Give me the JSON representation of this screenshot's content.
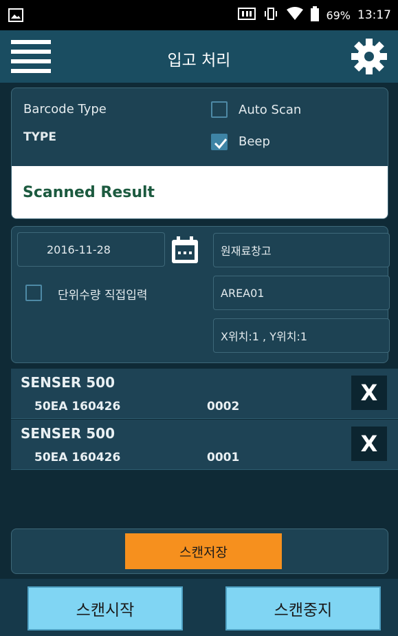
{
  "status_bar": {
    "battery": "69%",
    "time": "13:17"
  },
  "app_bar": {
    "title": "입고 처리",
    "menu_icon": "hamburger-menu-icon",
    "settings_icon": "gear-icon"
  },
  "scan_panel": {
    "barcode_type_label": "Barcode Type",
    "type_value": "TYPE",
    "auto_scan_label": "Auto Scan",
    "auto_scan_checked": false,
    "beep_label": "Beep",
    "beep_checked": true,
    "scanned_result_label": "Scanned Result"
  },
  "location_panel": {
    "date": "2016-11-28",
    "warehouse": "원재료창고",
    "area": "AREA01",
    "position": "X위치:1 , Y위치:1",
    "direct_input_label": "단위수량 직접입력",
    "direct_input_checked": false
  },
  "items": [
    {
      "name": "SENSER 500",
      "info": "50EA  160426",
      "seq": "0002",
      "delete_label": "X"
    },
    {
      "name": "SENSER 500",
      "info": "50EA  160426",
      "seq": "0001",
      "delete_label": "X"
    }
  ],
  "actions": {
    "save_label": "스캔저장",
    "start_label": "스캔시작",
    "stop_label": "스캔중지"
  },
  "colors": {
    "app_bar": "#1a4d61",
    "background": "#0f2a36",
    "save_button": "#f6901e",
    "bottom_button": "#80d5f3",
    "result_text": "#1c5a3f"
  }
}
